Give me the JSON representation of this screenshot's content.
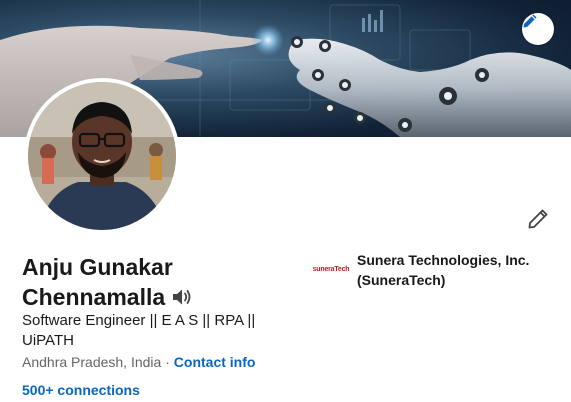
{
  "profile": {
    "name_line1": "Anju Gunakar",
    "name_line2": "Chennamalla",
    "headline": "Software Engineer || E A S || RPA || UiPATH",
    "location": "Andhra Pradesh, India",
    "separator": " · ",
    "contact_info": "Contact info",
    "connections": "500+ connections"
  },
  "company": {
    "logo_text": "suneraTech",
    "name_line1": "Sunera Technologies, Inc.",
    "name_line2": "(SuneraTech)"
  },
  "icons": {
    "banner_edit": "pencil-icon",
    "profile_edit": "pencil-icon",
    "name_pronunciation": "speaker-icon"
  },
  "colors": {
    "link": "#0a66c2",
    "text": "#191919",
    "muted": "#666666",
    "banner_dark": "#12243a",
    "logo_red": "#c0201f"
  }
}
